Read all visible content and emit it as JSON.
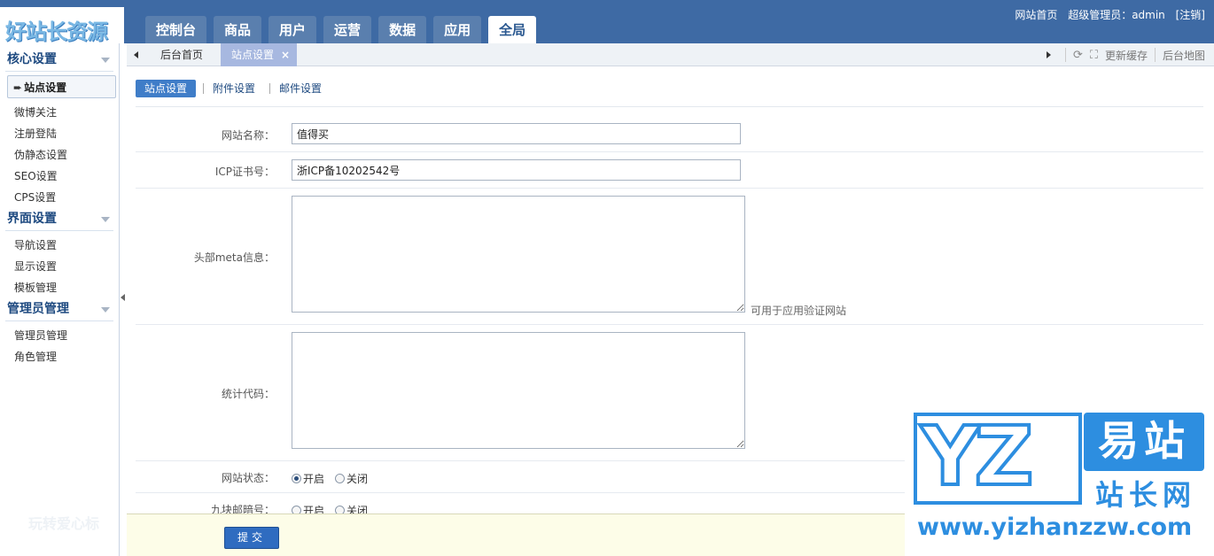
{
  "logo": {
    "text": "好站长资源"
  },
  "topnav": {
    "tabs": [
      {
        "label": "控制台"
      },
      {
        "label": "商品"
      },
      {
        "label": "用户"
      },
      {
        "label": "运营"
      },
      {
        "label": "数据"
      },
      {
        "label": "应用"
      },
      {
        "label": "全局",
        "active": true
      }
    ]
  },
  "topright": {
    "site_home": "网站首页",
    "role_label": "超级管理员：admin",
    "logout": "[注销]"
  },
  "sidebar": {
    "groups": [
      {
        "title": "核心设置",
        "items": [
          "站点设置",
          "微博关注",
          "注册登陆",
          "伪静态设置",
          "SEO设置",
          "CPS设置"
        ]
      },
      {
        "title": "界面设置",
        "items": [
          "导航设置",
          "显示设置",
          "模板管理"
        ]
      },
      {
        "title": "管理员管理",
        "items": [
          "管理员管理",
          "角色管理"
        ]
      }
    ]
  },
  "tabbar": {
    "home": "后台首页",
    "current": "站点设置",
    "close": "×",
    "refresh_cache": "更新缓存",
    "sitemap": "后台地图"
  },
  "subtabs": [
    "站点设置",
    "附件设置",
    "邮件设置"
  ],
  "form": {
    "site_name_label": "网站名称：",
    "site_name_value": "值得买",
    "icp_label": "ICP证书号：",
    "icp_value": "浙ICP备10202542号",
    "meta_label": "头部meta信息：",
    "meta_hint": "可用于应用验证网站",
    "stats_label": "统计代码：",
    "status_label": "网站状态：",
    "status_on": "开启",
    "status_off": "关闭",
    "grid_label": "九块邮暗号：",
    "grid_on": "开启",
    "grid_off": "关闭"
  },
  "footer": {
    "submit": "提交"
  },
  "watermark": {
    "yz": "YZ",
    "yi": "易站",
    "zzw": "站长网",
    "url": "www.yizhanzzw.com"
  },
  "faint": "玩转爱心标"
}
